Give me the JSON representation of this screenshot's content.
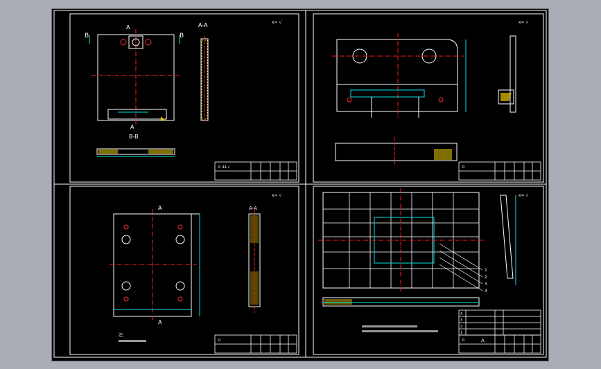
{
  "sheets": [
    {
      "id": "top-left",
      "section_labels": {
        "left_b": "B",
        "right_b": "B",
        "a_top": "A",
        "a_bottom": "A",
        "view_aa": "A-A",
        "view_bb": "B-B"
      },
      "roughness": "x= √",
      "title_block": {
        "r1": "©  44  √"
      }
    },
    {
      "id": "top-right",
      "roughness": "x= √",
      "title_block": {
        "r1": "©"
      }
    },
    {
      "id": "bottom-left",
      "section_labels": {
        "a_top": "A",
        "a_bottom": "A",
        "view_aa": "A-A"
      },
      "roughness": "x= √",
      "note_title": "注:",
      "title_block": {
        "r1": "©"
      }
    },
    {
      "id": "bottom-right",
      "roughness": "x= √",
      "balloons": [
        "1",
        "2",
        "3",
        "4"
      ],
      "bom_rows": [
        "4",
        "3",
        "2",
        "1"
      ],
      "title_block": {
        "r1": "©",
        "r2": "A"
      }
    }
  ],
  "colors": {
    "frame": "#000000",
    "border": "#ffffff",
    "outline": "#ffffff",
    "centerline": "#ff2020",
    "dimension": "#00e5e5",
    "hatch": "#e8c800",
    "annotation": "#ffff33",
    "hidden": "#cc2020"
  }
}
